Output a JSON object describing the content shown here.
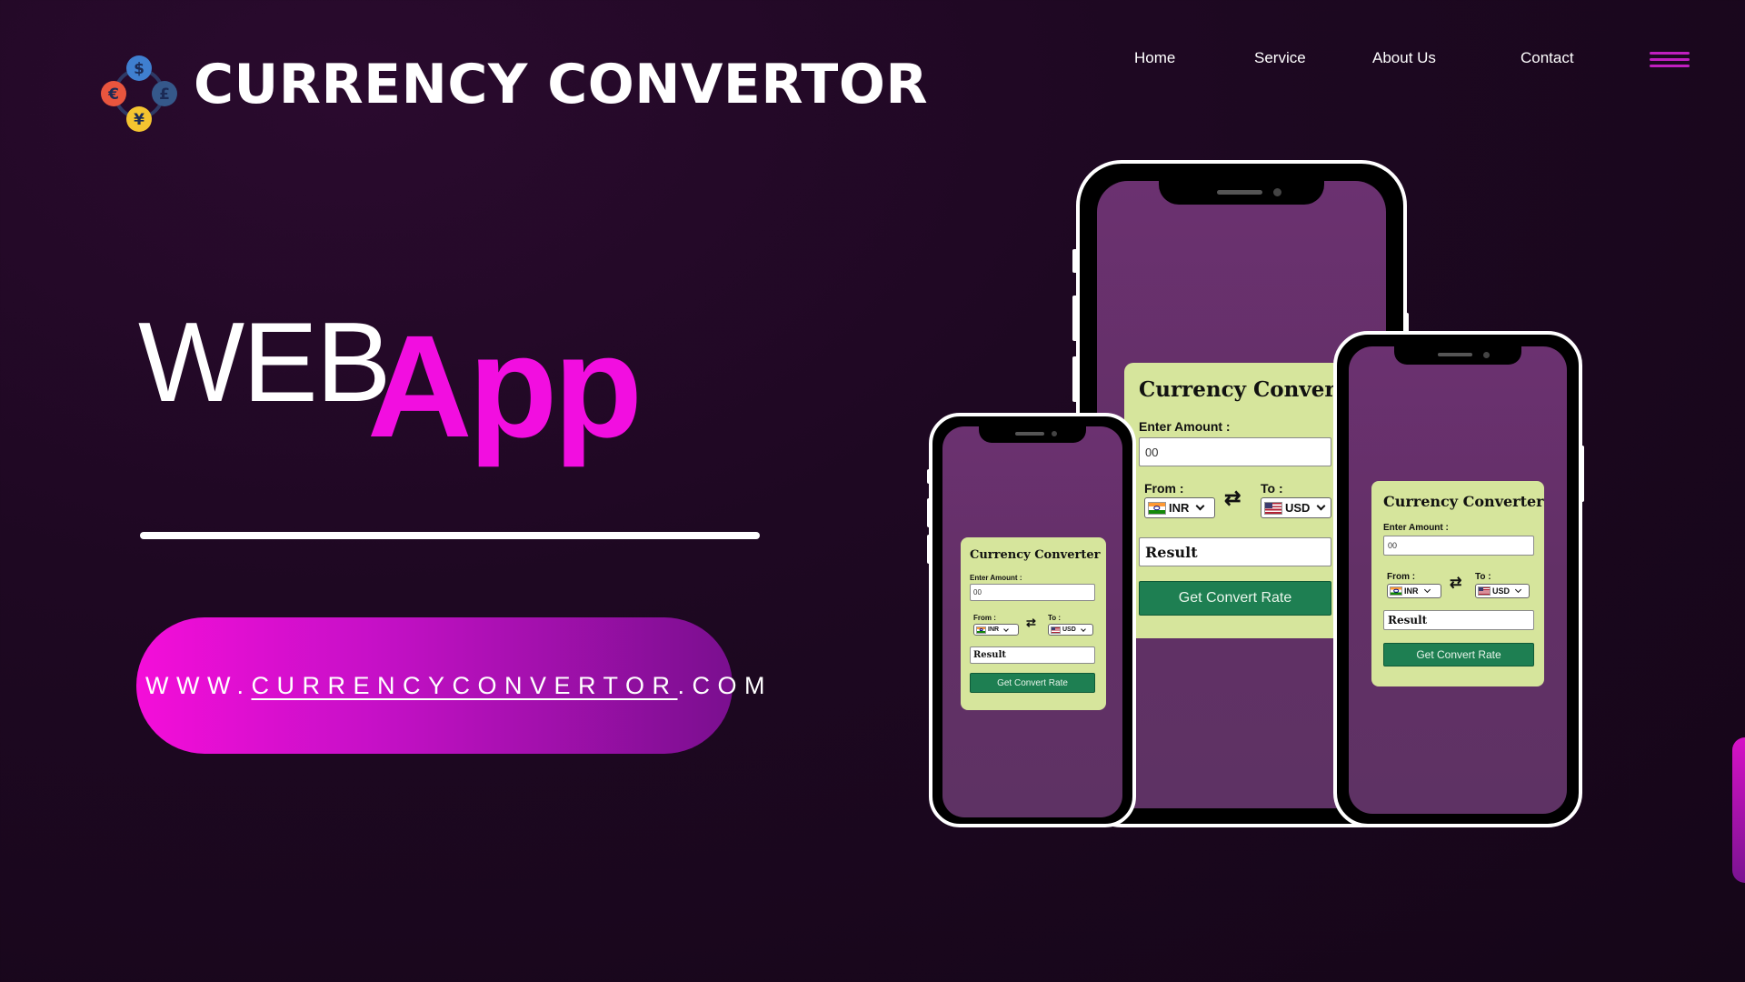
{
  "brand": {
    "title": "CURRENCY CONVERTOR",
    "logo_icon": "currency-exchange-icon",
    "logo_symbols": [
      "$",
      "€",
      "£",
      "¥"
    ]
  },
  "nav": {
    "items": [
      {
        "label": "Home"
      },
      {
        "label": "Service"
      },
      {
        "label": "About Us"
      },
      {
        "label": "Contact"
      }
    ],
    "menu_icon": "hamburger-menu-icon"
  },
  "hero": {
    "word1": "WEB",
    "word2": "App"
  },
  "url": {
    "prefix": "WWW.",
    "domain": "CURRENCYCONVERTOR",
    "suffix": ".COM"
  },
  "converter": {
    "title": "Currency Converter",
    "amount_label": "Enter Amount :",
    "amount_value": "00",
    "from_label": "From :",
    "to_label": "To :",
    "from_currency": "INR",
    "to_currency": "USD",
    "swap_icon": "swap-arrows-icon",
    "result_label": "Result",
    "button_label": "Get Convert Rate"
  },
  "colors": {
    "accent": "#f20ee0",
    "background": "#1e0822",
    "card": "#d6e59c",
    "button": "#1e7f52"
  }
}
